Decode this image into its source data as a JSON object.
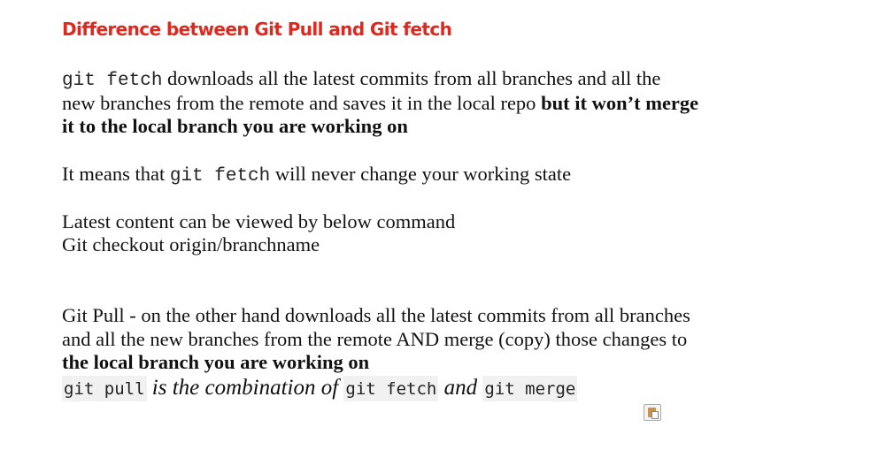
{
  "title": "Difference between Git Pull and Git fetch",
  "p1": {
    "code": "git fetch",
    "l1": " downloads all the latest commits from all branches and all the",
    "l2a": "new branches from the remote and saves it in the local repo ",
    "l2b": "but it won’t merge",
    "l3": "it to the local branch you are working on"
  },
  "p2": {
    "a": "It means that ",
    "code": "git fetch",
    "b": " will never change your working state"
  },
  "p3": {
    "l1": "Latest content can be viewed by below command",
    "l2": "Git checkout origin/branchname"
  },
  "p4": {
    "l1": "Git Pull - on the other hand downloads all the latest commits from all branches",
    "l2": "and all the new branches from the remote AND merge (copy) those changes to",
    "l3": "the local branch you are working on",
    "code1": "git pull",
    "t1": " is the combination of ",
    "code2": "git fetch",
    "t2": " and ",
    "code3": "git merge "
  },
  "icons": {
    "paste": "clipboard-icon"
  },
  "colors": {
    "title": "#e0281e"
  }
}
